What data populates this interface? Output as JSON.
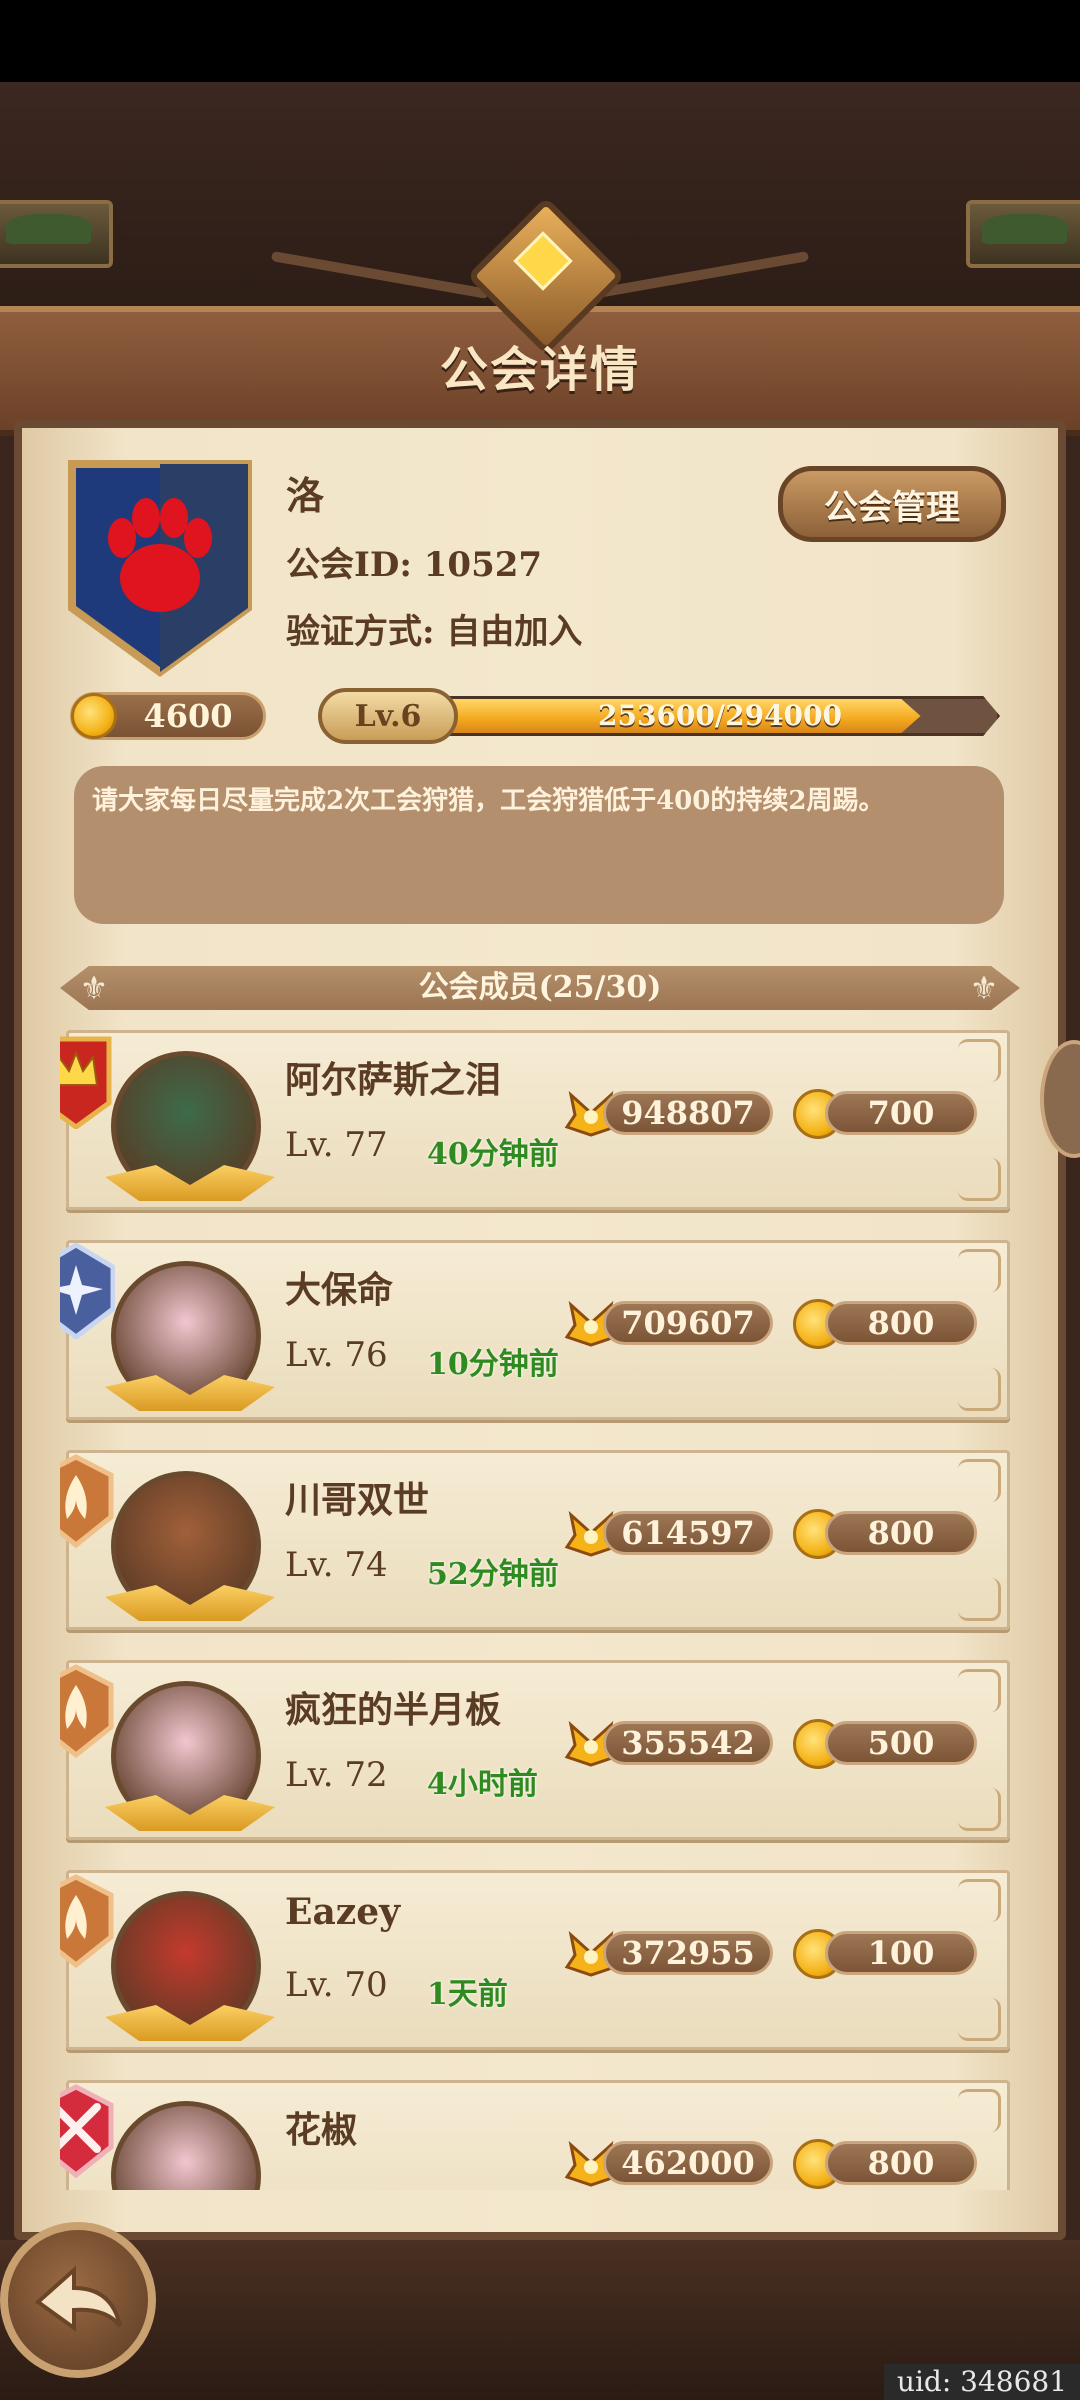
{
  "window": {
    "title": "公会详情"
  },
  "guild": {
    "name": "洛",
    "id_label": "公会ID: 10527",
    "verify_label": "验证方式: 自由加入",
    "manage_button": "公会管理",
    "funds": "4600",
    "level_label": "Lv.6",
    "xp_text": "253600/294000",
    "xp_fraction": 0.862,
    "notice": "请大家每日尽量完成2次工会狩猎，工会狩猎低于400的持续2周踢。",
    "colors": {
      "shield": "#1e3a7a",
      "paw": "#e0141e",
      "accent": "#f3a81f"
    }
  },
  "members": {
    "header": "公会成员(25/30)",
    "rows": [
      {
        "name": "阿尔萨斯之泪",
        "level": "Lv. 77",
        "last_online": "40分钟前",
        "power": "948807",
        "contribution": "700",
        "rank_icon": "crown-badge-icon",
        "avatar_color": "#3d6b4a"
      },
      {
        "name": "大保命",
        "level": "Lv. 76",
        "last_online": "10分钟前",
        "power": "709607",
        "contribution": "800",
        "rank_icon": "star-badge-icon",
        "avatar_color": "#f2c6cf"
      },
      {
        "name": "川哥双世",
        "level": "Lv. 74",
        "last_online": "52分钟前",
        "power": "614597",
        "contribution": "800",
        "rank_icon": "flame-badge-icon",
        "avatar_color": "#a0603a"
      },
      {
        "name": "疯狂的半月板",
        "level": "Lv. 72",
        "last_online": "4小时前",
        "power": "355542",
        "contribution": "500",
        "rank_icon": "flame-badge-icon",
        "avatar_color": "#f2c6cf"
      },
      {
        "name": "Eazey",
        "level": "Lv. 70",
        "last_online": "1天前",
        "power": "372955",
        "contribution": "100",
        "rank_icon": "flame-badge-icon",
        "avatar_color": "#c43a2e"
      },
      {
        "name": "花椒",
        "level": "",
        "last_online": "",
        "power": "462000",
        "contribution": "800",
        "rank_icon": "swords-badge-icon",
        "avatar_color": "#f2c6cf"
      }
    ]
  },
  "footer": {
    "uid": "uid: 348681",
    "back_icon": "back-arrow-icon"
  }
}
